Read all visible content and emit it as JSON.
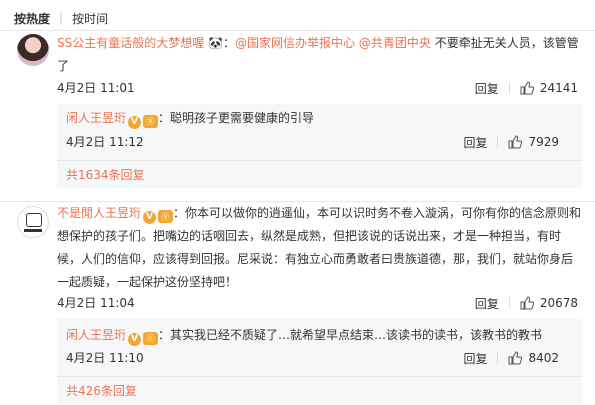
{
  "tabs": {
    "hot": "按热度",
    "time": "按时间"
  },
  "comments": [
    {
      "user": "SS公主有童话般的大梦想喔",
      "mentions": [
        "@国家网信办举报中心",
        "@共青团中央"
      ],
      "text": "不要牵扯无关人员，该管管了",
      "date": "4月2日 11:01",
      "reply_label": "回复",
      "likes": "24141",
      "reply": {
        "user": "闲人王昱珩",
        "text": "：聪明孩子更需要健康的引导",
        "date": "4月2日 11:12",
        "reply_label": "回复",
        "likes": "7929"
      },
      "more": "共1634条回复"
    },
    {
      "user": "不是閒人王昱珩",
      "text": "：你本可以做你的逍遥仙，本可以识时务不卷入漩涡，可你有你的信念原则和想保护的孩子们。把嘴边的话咽回去，纵然是成熟，但把该说的话说出来，才是一种担当，有时候，人们的信仰，应该得到回报。尼采说：有独立心而勇敢者曰贵族道德，那，我们，就站你身后一起质疑，一起保护这份坚持吧！",
      "date": "4月2日 11:04",
      "reply_label": "回复",
      "likes": "20678",
      "reply": {
        "user": "闲人王昱珩",
        "text": "：其实我已经不质疑了…就希望早点结束…该读书的读书，该教书的教书",
        "date": "4月2日 11:10",
        "reply_label": "回复",
        "likes": "8402"
      },
      "more": "共426条回复"
    }
  ],
  "colors": {
    "accent": "#eb7350",
    "gold": "#f3a733"
  }
}
